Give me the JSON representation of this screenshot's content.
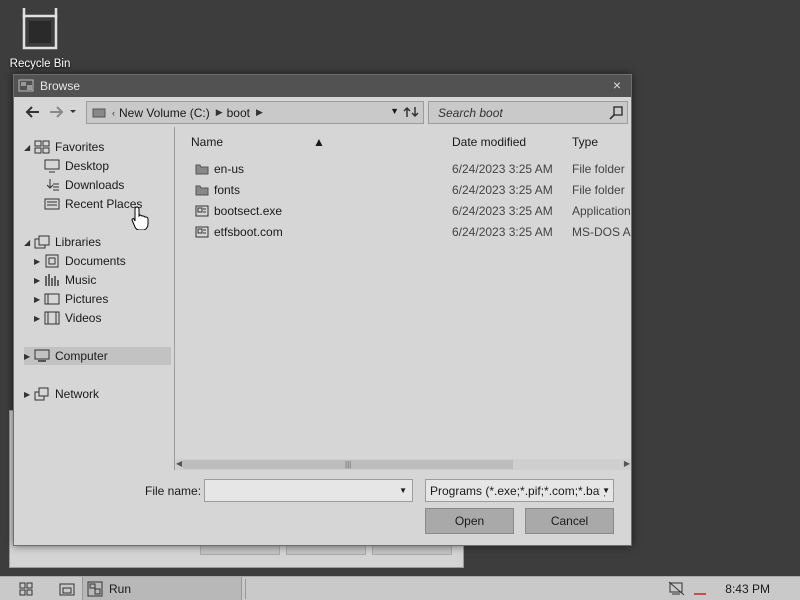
{
  "desktop": {
    "recycle_bin_label": "Recycle Bin"
  },
  "dialog": {
    "title": "Browse",
    "close_glyph": "×",
    "address": {
      "segments": [
        "New Volume (C:)",
        "boot"
      ]
    },
    "search": {
      "placeholder": "Search boot"
    },
    "tree": {
      "favorites": {
        "label": "Favorites",
        "items": [
          "Desktop",
          "Downloads",
          "Recent Places"
        ]
      },
      "libraries": {
        "label": "Libraries",
        "items": [
          "Documents",
          "Music",
          "Pictures",
          "Videos"
        ]
      },
      "computer": {
        "label": "Computer"
      },
      "network": {
        "label": "Network"
      }
    },
    "columns": {
      "name": "Name",
      "date": "Date modified",
      "type": "Type"
    },
    "files": [
      {
        "name": "en-us",
        "date": "6/24/2023 3:25 AM",
        "type": "File folder",
        "icon": "folder-icon"
      },
      {
        "name": "fonts",
        "date": "6/24/2023 3:25 AM",
        "type": "File folder",
        "icon": "folder-icon"
      },
      {
        "name": "bootsect.exe",
        "date": "6/24/2023 3:25 AM",
        "type": "Application",
        "icon": "application-icon"
      },
      {
        "name": "etfsboot.com",
        "date": "6/24/2023 3:25 AM",
        "type": "MS-DOS Ap",
        "icon": "application-icon"
      }
    ],
    "filename_label": "File name:",
    "filename_value": "",
    "filetype_value": "Programs (*.exe;*.pif;*.com;*.bat;",
    "open_label": "Open",
    "cancel_label": "Cancel"
  },
  "taskbar": {
    "run_label": "Run",
    "clock": "8:43 PM"
  },
  "colors": {
    "desktop_bg": "#3d3d3d",
    "titlebar": "#525252",
    "dialog_bg": "#d6d6d6",
    "taskbar": "#c9c9c9",
    "tray_alert": "#cc2222"
  }
}
